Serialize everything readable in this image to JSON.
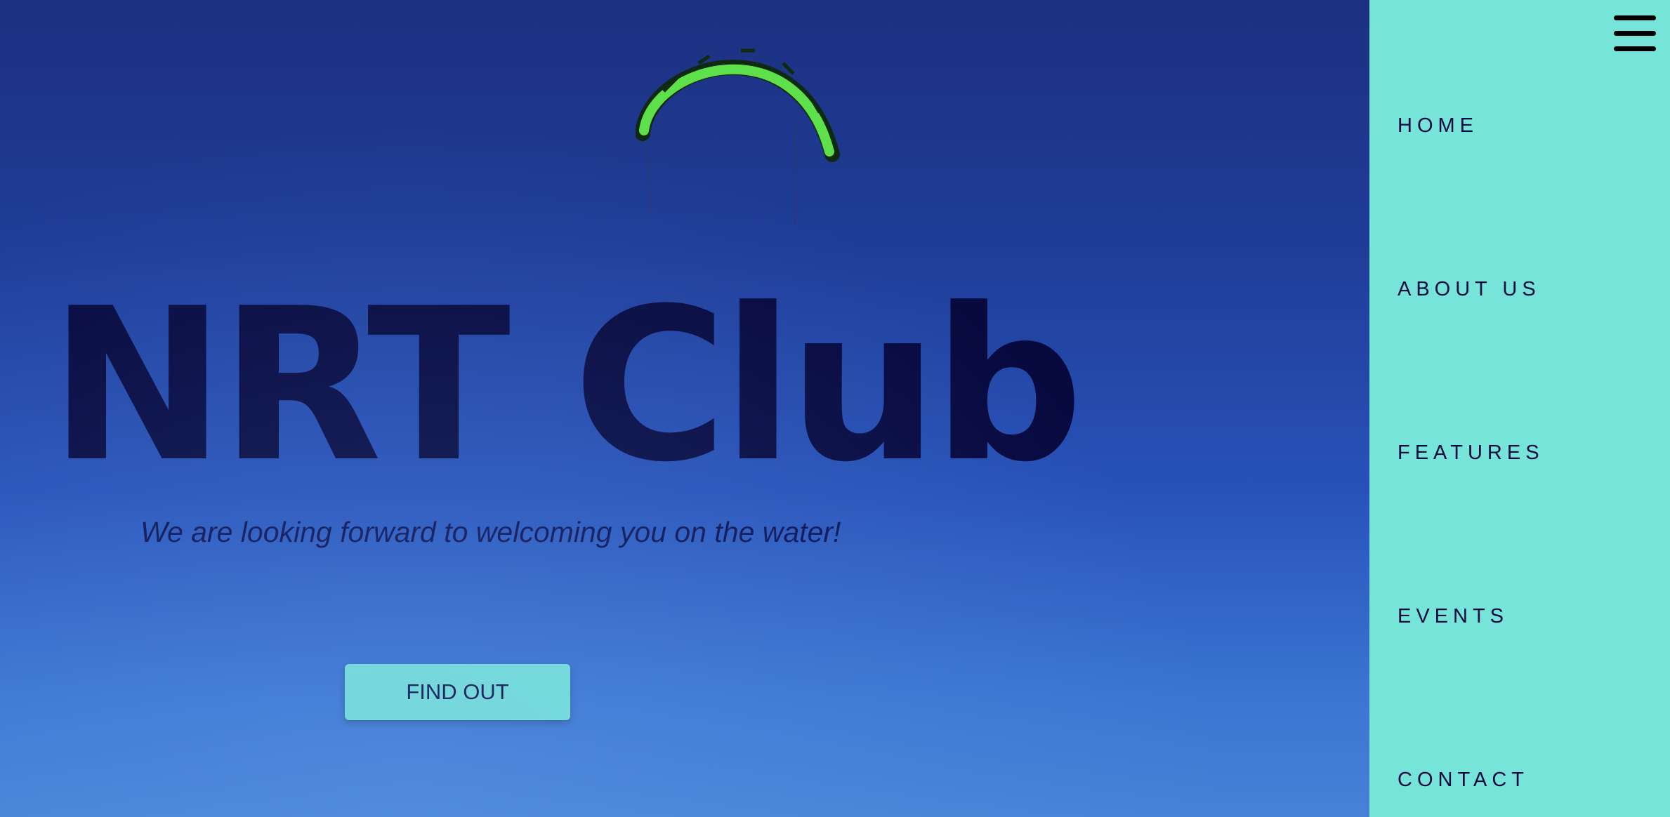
{
  "hero": {
    "title": "NRT Club",
    "subtitle": "We are looking forward to welcoming you on the water!",
    "cta_label": "FIND OUT"
  },
  "nav": {
    "items": [
      {
        "label": "HOME"
      },
      {
        "label": "ABOUT US"
      },
      {
        "label": "FEATURES"
      },
      {
        "label": "EVENTS"
      },
      {
        "label": "CONTACT"
      }
    ]
  },
  "icons": {
    "menu": "hamburger-menu-icon"
  },
  "colors": {
    "accent": "#76e4d8",
    "title_text": "#07093f",
    "sky_top": "#1c3080",
    "sky_bottom": "#4682d6",
    "kite_green": "#5ee04a"
  }
}
